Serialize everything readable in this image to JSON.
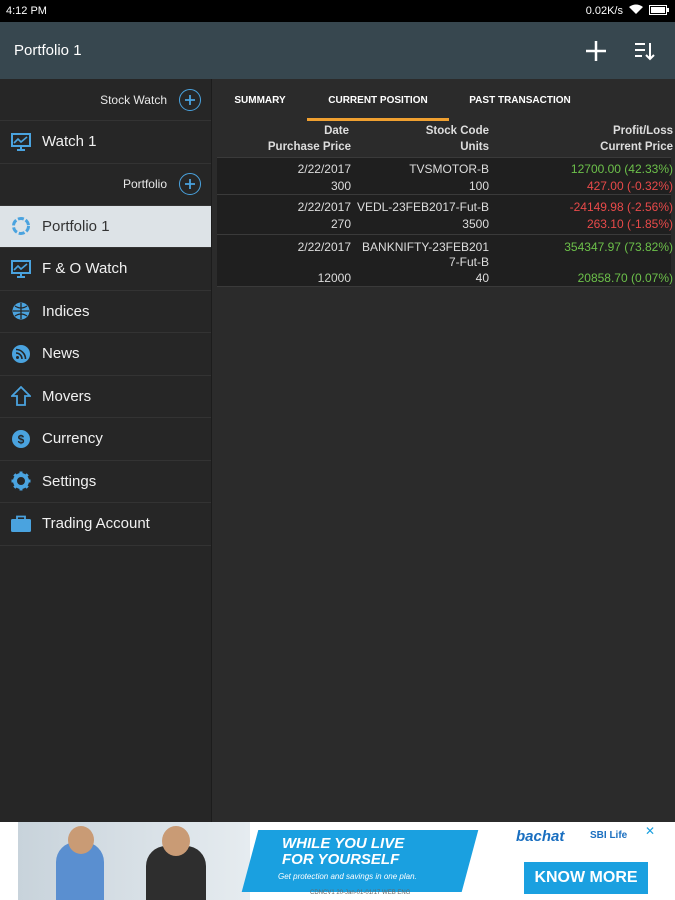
{
  "status": {
    "time": "4:12 PM",
    "net": "0.02K/s"
  },
  "appbar": {
    "title": "Portfolio 1"
  },
  "sidebar": {
    "stock_watch_header": "Stock Watch",
    "watch_item": "Watch 1",
    "portfolio_header": "Portfolio",
    "items": [
      {
        "label": "Portfolio 1",
        "icon": "ring-icon"
      },
      {
        "label": "F & O Watch",
        "icon": "monitor-icon"
      },
      {
        "label": "Indices",
        "icon": "globe-icon"
      },
      {
        "label": "News",
        "icon": "rss-icon"
      },
      {
        "label": "Movers",
        "icon": "arrow-up-icon"
      },
      {
        "label": "Currency",
        "icon": "dollar-icon"
      },
      {
        "label": "Settings",
        "icon": "gear-icon"
      },
      {
        "label": "Trading Account",
        "icon": "briefcase-icon"
      }
    ]
  },
  "tabs": [
    "SUMMARY",
    "CURRENT POSITION",
    "PAST TRANSACTION"
  ],
  "table": {
    "headers": {
      "date": "Date",
      "purchase_price": "Purchase Price",
      "stock_code": "Stock Code",
      "units": "Units",
      "profit_loss": "Profit/Loss",
      "current_price": "Current Price"
    },
    "rows": [
      {
        "date": "2/22/2017",
        "code": "TVSMOTOR-B",
        "code2": "",
        "pl": "12700.00 (42.33%)",
        "pl_color": "#6cc04a",
        "purchase": "300",
        "units": "100",
        "current": "427.00 (-0.32%)",
        "cur_color": "#e84a4a"
      },
      {
        "date": "2/22/2017",
        "code": "VEDL-23FEB2017-Fut-B",
        "code2": "",
        "pl": "-24149.98 (-2.56%)",
        "pl_color": "#e84a4a",
        "purchase": "270",
        "units": "3500",
        "current": "263.10 (-1.85%)",
        "cur_color": "#e84a4a"
      },
      {
        "date": "2/22/2017",
        "code": "BANKNIFTY-23FEB201",
        "code2": "7-Fut-B",
        "pl": "354347.97 (73.82%)",
        "pl_color": "#6cc04a",
        "purchase": "12000",
        "units": "40",
        "current": "20858.70 (0.07%)",
        "cur_color": "#6cc04a"
      }
    ]
  },
  "ad": {
    "headline1": "WHILE YOU LIVE",
    "headline2": "FOR YOURSELF",
    "sub": "Get protection and savings in one plan.",
    "fine": "CDNCV1 20-Jan-01-01/17 WEB ENG",
    "brand1": "bachat",
    "brand2": "SBI Life",
    "cta": "KNOW MORE"
  },
  "colors": {
    "appbar": "#37474f",
    "accent": "#f0a030",
    "green": "#6cc04a",
    "red": "#e84a4a"
  }
}
